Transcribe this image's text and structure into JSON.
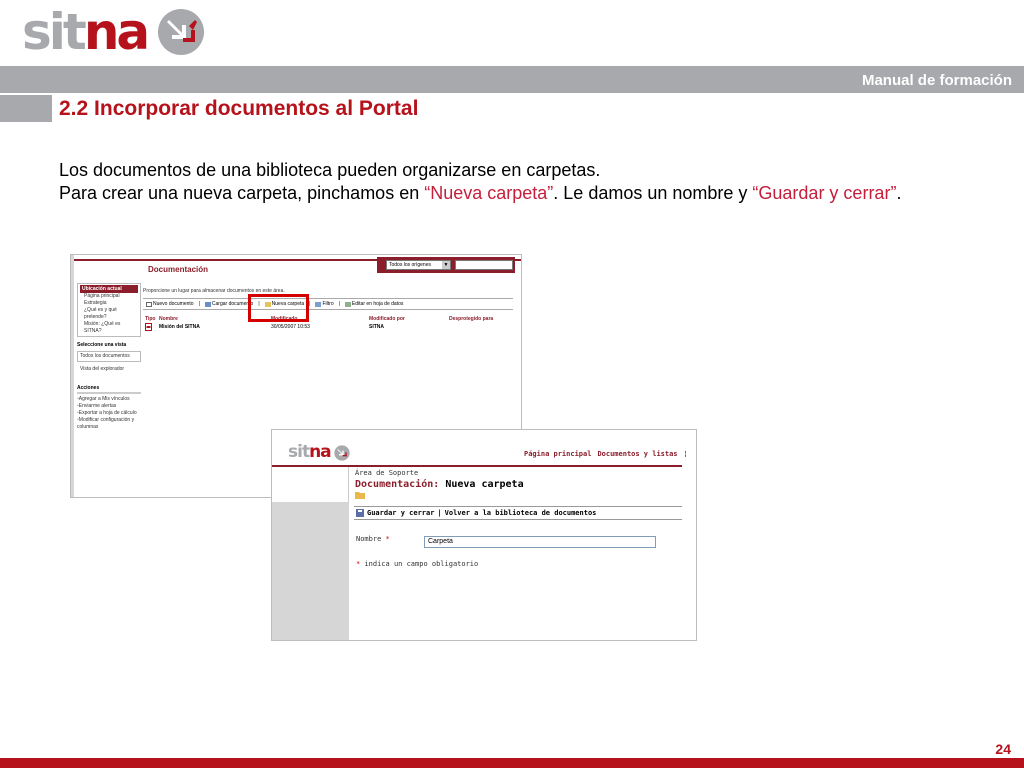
{
  "header": {
    "logo": {
      "part1": "sit",
      "part2": "na",
      "mark_icon": "sitna-arrows-icon"
    },
    "manual_label": "Manual de formación",
    "section_title": "2.2 Incorporar documentos al Portal"
  },
  "body": {
    "line1": "Los documentos de una biblioteca pueden organizarse en carpetas.",
    "line2_pre": "Para crear una nueva carpeta, pinchamos en ",
    "line2_q1": "“Nueva carpeta”",
    "line2_mid": ". Le damos un nombre y ",
    "line2_q2": "“Guardar y cerrar”",
    "line2_end": "."
  },
  "library_screenshot": {
    "title": "Documentación",
    "search_scope": "Todos los orígenes",
    "nav": {
      "location_header": "Ubicación actual",
      "location_items": [
        "Página principal",
        "Estrategia",
        "¿Qué es y qué pretende?",
        "Misión: ¿Qué es SITNA?"
      ],
      "view_section": "Seleccione una vista",
      "view_items": [
        "Todos los documentos",
        "Vista del explorador"
      ],
      "actions_section": "Acciones",
      "action_items": [
        "Agregar a Mis vínculos",
        "Enviarme alertas",
        "Exportar a hoja de cálculo",
        "Modificar configuración y columnas"
      ]
    },
    "description": "Proporcione un lugar para almacenar documentos en este área.",
    "toolbar": [
      "Nuevo documento",
      "Cargar documento",
      "Nueva carpeta",
      "Filtro",
      "Editar en hoja de datos"
    ],
    "columns": [
      "Tipo",
      "Nombre",
      "Modificado",
      "Modificado por",
      "Desprotegido para"
    ],
    "rows": [
      {
        "name": "Misión del SITNA",
        "modified": "30/05/2007 10:53",
        "modified_by": "SITNA",
        "checked_out": ""
      }
    ]
  },
  "newfolder_screenshot": {
    "logo": {
      "part1": "sit",
      "part2": "na"
    },
    "nav_links": [
      "Página principal",
      "Documentos y listas"
    ],
    "breadcrumb": "Área de Soporte",
    "title_a": "Documentación",
    "title_sep": ": ",
    "title_b": "Nueva carpeta",
    "toolbar": {
      "save": "Guardar y cerrar",
      "separator": "|",
      "back": "Volver a la biblioteca de documentos"
    },
    "name_label": "Nombre",
    "required_mark": "*",
    "name_value": "Carpeta",
    "required_note": "indica un campo obligatorio"
  },
  "footer": {
    "page_number": "24"
  },
  "colors": {
    "brand_red": "#b5121b",
    "brand_gray": "#a7a9ac",
    "accent_red": "#c41e3a",
    "highlight": "#d40000"
  }
}
